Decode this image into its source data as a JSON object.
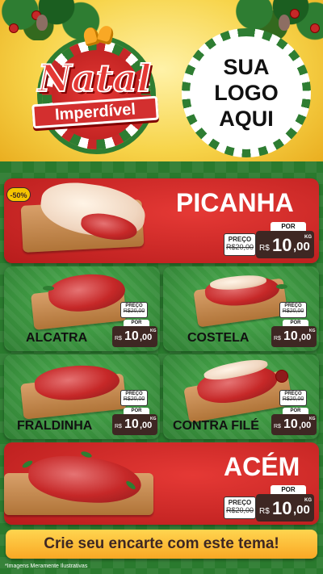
{
  "header": {
    "badge_title": "Natal",
    "badge_subtitle": "Imperdível",
    "logo_lines": [
      "SUA",
      "LOGO",
      "AQUI"
    ]
  },
  "discount_badge": "-50%",
  "products": [
    {
      "name": "PICANHA",
      "preco_label": "PREÇO",
      "old_price": "R$20,00",
      "por_label": "POR",
      "currency": "R$",
      "price_int": "10",
      "price_dec": ",00",
      "unit": "KG"
    },
    {
      "name": "ALCATRA",
      "preco_label": "PREÇO",
      "old_price": "R$20,00",
      "por_label": "POR",
      "currency": "R$",
      "price_int": "10",
      "price_dec": ",00",
      "unit": "KG"
    },
    {
      "name": "COSTELA",
      "preco_label": "PREÇO",
      "old_price": "R$20,00",
      "por_label": "POR",
      "currency": "R$",
      "price_int": "10",
      "price_dec": ",00",
      "unit": "KG"
    },
    {
      "name": "FRALDINHA",
      "preco_label": "PREÇO",
      "old_price": "R$20,00",
      "por_label": "POR",
      "currency": "R$",
      "price_int": "10",
      "price_dec": ",00",
      "unit": "KG"
    },
    {
      "name": "CONTRA FILÉ",
      "preco_label": "PREÇO",
      "old_price": "R$20,00",
      "por_label": "POR",
      "currency": "R$",
      "price_int": "10",
      "price_dec": ",00",
      "unit": "KG"
    },
    {
      "name": "ACÉM",
      "preco_label": "PREÇO",
      "old_price": "R$20,00",
      "por_label": "POR",
      "currency": "R$",
      "price_int": "10",
      "price_dec": ",00",
      "unit": "KG"
    }
  ],
  "cta": "Crie seu encarte com este tema!",
  "disclaimer": "*Imagens Meramente Ilustrativas",
  "colors": {
    "red": "#c62828",
    "green": "#2e7d32",
    "gold": "#f9a825",
    "brown": "#3e2723"
  }
}
